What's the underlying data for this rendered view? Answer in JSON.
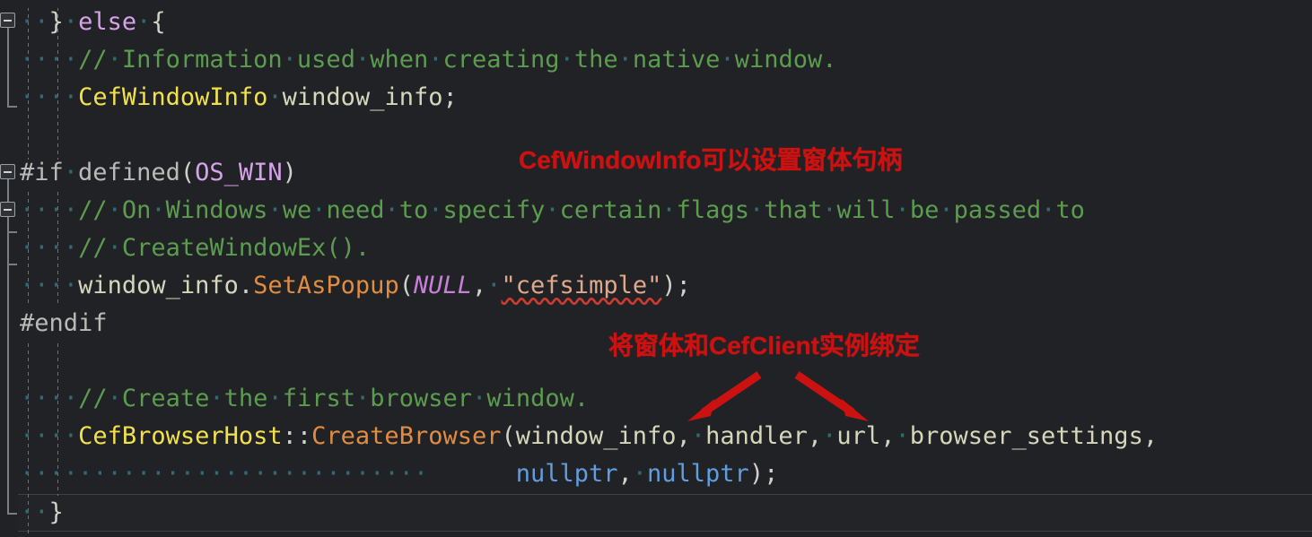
{
  "editor": {
    "theme": "dark",
    "background": "#212226",
    "language": "cpp",
    "colors": {
      "comment": "#5b9c4e",
      "type": "#f2e14c",
      "keyword": "#d7a3e8",
      "function": "#e08c43",
      "string": "#e0a88a",
      "constant": "#c77fd8",
      "null_literal": "#5f9ee0",
      "identifier": "#d6d6bb",
      "whitespace_dot": "#2f6b72",
      "annotation_red": "#cc1111",
      "error_squiggle": "#cc3b30"
    },
    "lines": [
      {
        "indent": 2,
        "text": "} else {"
      },
      {
        "indent": 4,
        "text": "// Information used when creating the native window."
      },
      {
        "indent": 4,
        "text": "CefWindowInfo window_info;"
      },
      {
        "indent": 4,
        "text": ""
      },
      {
        "indent": 0,
        "text": "#if defined(OS_WIN)"
      },
      {
        "indent": 4,
        "text": "// On Windows we need to specify certain flags that will be passed to"
      },
      {
        "indent": 4,
        "text": "// CreateWindowEx()."
      },
      {
        "indent": 4,
        "text": "window_info.SetAsPopup(NULL, \"cefsimple\");"
      },
      {
        "indent": 0,
        "text": "#endif"
      },
      {
        "indent": 4,
        "text": ""
      },
      {
        "indent": 4,
        "text": "// Create the first browser window."
      },
      {
        "indent": 4,
        "text": "CefBrowserHost::CreateBrowser(window_info, handler, url, browser_settings,"
      },
      {
        "indent": 34,
        "text": "nullptr, nullptr);"
      },
      {
        "indent": 2,
        "text": "}"
      }
    ]
  },
  "gutter": {
    "fold_markers": [
      {
        "state": "expanded",
        "glyph": "minus"
      },
      {
        "state": "expanded",
        "glyph": "minus"
      },
      {
        "state": "expanded",
        "glyph": "minus"
      }
    ]
  },
  "annotations": [
    {
      "text": "CefWindowInfo可以设置窗体句柄",
      "color": "#cc1111"
    },
    {
      "text": "将窗体和CefClient实例绑定",
      "color": "#cc1111"
    }
  ],
  "arrows": [
    {
      "name": "arrow-to-window-info",
      "direction": "down-left",
      "color": "#cc1111"
    },
    {
      "name": "arrow-to-handler",
      "direction": "down-right",
      "color": "#cc1111"
    }
  ],
  "errors": [
    {
      "token": "\"cefsimple\"",
      "marker": "red-wavy-underline"
    }
  ]
}
